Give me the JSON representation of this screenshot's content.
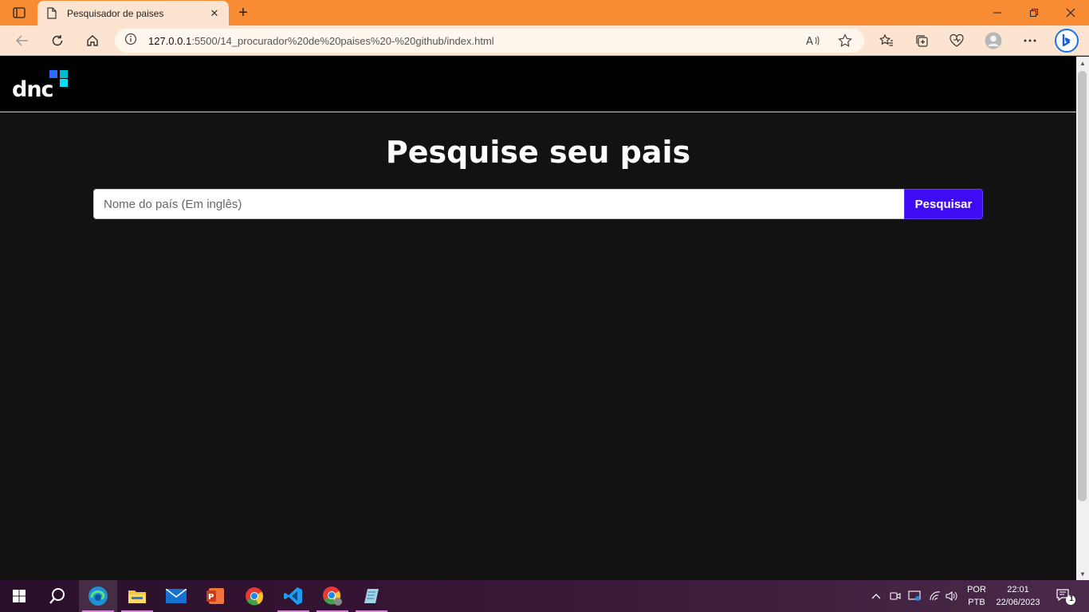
{
  "browser": {
    "tab_title": "Pesquisador de paises",
    "url_host": "127.0.0.1",
    "url_path": ":5500/14_procurador%20de%20paises%20-%20github/index.html",
    "new_tab_symbol": "+",
    "close_tab_symbol": "✕"
  },
  "site": {
    "logo_text": "dnc",
    "heading": "Pesquise seu pais",
    "search": {
      "placeholder": "Nome do país (Em inglês)",
      "value": "",
      "button_label": "Pesquisar"
    }
  },
  "taskbar": {
    "apps": [
      "start-icon",
      "search-icon",
      "edge-icon",
      "file-explorer-icon",
      "mail-icon",
      "powerpoint-icon",
      "chrome-icon",
      "vscode-icon",
      "chrome-profile-icon",
      "notepad-icon"
    ],
    "lang_line1": "POR",
    "lang_line2": "PTB",
    "time": "22:01",
    "date": "22/06/2023",
    "notification_count": "1"
  },
  "colors": {
    "titlebar": "#f78c35",
    "toolbar": "#fce4d0",
    "page_bg": "#121212",
    "header_bg": "#000000",
    "button_bg": "#3d0cf5"
  }
}
